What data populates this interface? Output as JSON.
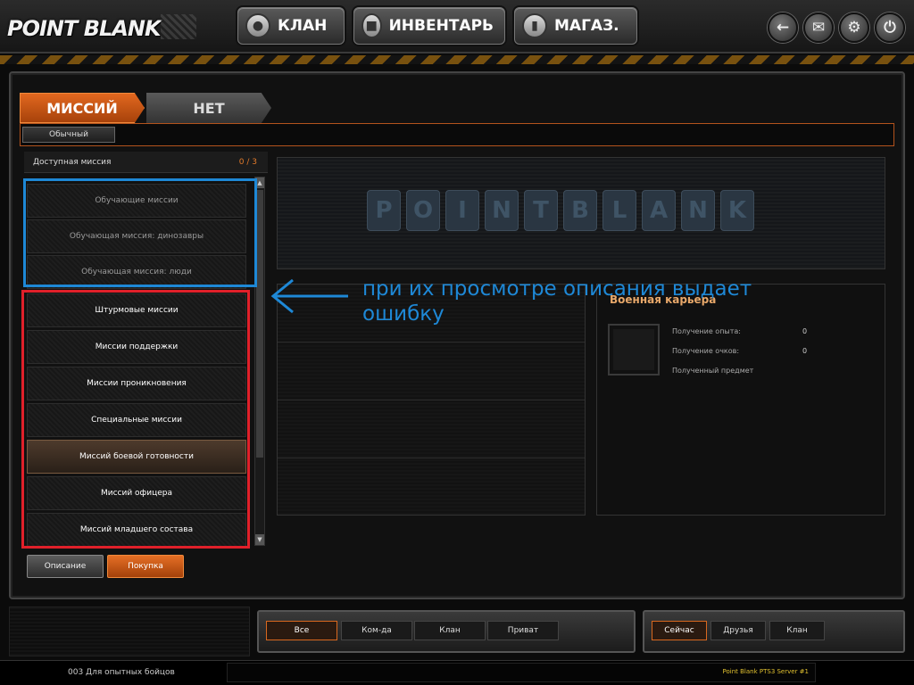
{
  "header": {
    "logo": "POINT BLANK",
    "nav": [
      {
        "label": "КЛАН",
        "icon": "user-icon"
      },
      {
        "label": "ИНВЕНТАРЬ",
        "icon": "cart-icon"
      },
      {
        "label": "МАГАЗ.",
        "icon": "briefcase-icon"
      }
    ],
    "system_buttons": [
      "back-arrow-icon",
      "mail-icon",
      "gear-icon",
      "power-icon"
    ]
  },
  "tabs": {
    "active": "МИССИЙ",
    "inactive": "НЕТ"
  },
  "filter": {
    "label": "Обычный"
  },
  "mission_list": {
    "header_label": "Доступная миссия",
    "count": "0 / 3",
    "items": [
      {
        "label": "Обучающие миссии",
        "state": "dim"
      },
      {
        "label": "Обучающая миссия: динозавры",
        "state": "dim"
      },
      {
        "label": "Обучающая миссия: люди",
        "state": "dim"
      },
      {
        "label": "Штурмовые миссии",
        "state": "bright"
      },
      {
        "label": "Миссии поддержки",
        "state": "bright"
      },
      {
        "label": "Миссии проникновения",
        "state": "bright"
      },
      {
        "label": "Специальные миссии",
        "state": "bright"
      },
      {
        "label": "Миссий боевой готовности",
        "state": "selected"
      },
      {
        "label": "Миссий офицера",
        "state": "bright"
      },
      {
        "label": "Миссий младшего состава",
        "state": "bright"
      }
    ]
  },
  "actions": {
    "description": "Описание",
    "purchase": "Покупка"
  },
  "banner": {
    "letters": [
      "P",
      "O",
      "I",
      "N",
      "T",
      "B",
      "L",
      "A",
      "N",
      "K"
    ]
  },
  "career": {
    "title": "Военная карьера",
    "exp_label": "Получение опыта:",
    "exp_value": "0",
    "points_label": "Получение очков:",
    "points_value": "0",
    "item_label": "Полученный предмет"
  },
  "annotation": {
    "text": "при их просмотре описания выдает ошибку",
    "color": "#1e88d6",
    "highlight_colors": {
      "blue": "#1e88d6",
      "red": "#e0202a"
    }
  },
  "chat": {
    "tabs": [
      "Все",
      "Ком-да",
      "Клан",
      "Приват"
    ],
    "active_tab": "Все",
    "friend_tabs": [
      "Сейчас",
      "Друзья",
      "Клан"
    ],
    "active_friend_tab": "Сейчас"
  },
  "status": {
    "message": "003 Для опытных бойцов",
    "server": "Point Blank PTS3 Server #1"
  },
  "colors": {
    "accent": "#e2681f",
    "background": "#111111"
  }
}
